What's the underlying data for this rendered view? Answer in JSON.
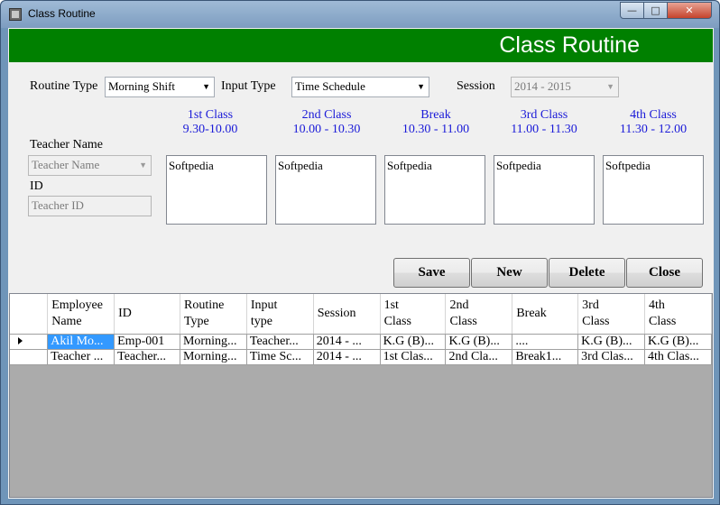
{
  "window": {
    "title": "Class Routine",
    "minimize_label": "—",
    "maximize_label": "□",
    "close_label": "✕"
  },
  "header": {
    "title": "Class Routine"
  },
  "form": {
    "routine_type_label": "Routine Type",
    "routine_type_value": "Morning Shift",
    "input_type_label": "Input Type",
    "input_type_value": "Time Schedule",
    "session_label": "Session",
    "session_value": "2014 - 2015",
    "teacher_name_label": "Teacher Name",
    "teacher_name_placeholder": "Teacher Name",
    "id_label": "ID",
    "teacher_id_placeholder": "Teacher ID"
  },
  "slots": [
    {
      "name": "1st Class",
      "time": "9.30-10.00",
      "value": "Softpedia"
    },
    {
      "name": "2nd Class",
      "time": "10.00 - 10.30",
      "value": "Softpedia"
    },
    {
      "name": "Break",
      "time": "10.30 - 11.00",
      "value": "Softpedia"
    },
    {
      "name": "3rd Class",
      "time": "11.00 - 11.30",
      "value": "Softpedia"
    },
    {
      "name": "4th Class",
      "time": "11.30 - 12.00",
      "value": "Softpedia"
    }
  ],
  "buttons": {
    "save": "Save",
    "new": "New",
    "delete": "Delete",
    "close": "Close"
  },
  "grid": {
    "columns": [
      {
        "line1": "Employee",
        "line2": "Name"
      },
      {
        "line1": "ID",
        "line2": ""
      },
      {
        "line1": "Routine",
        "line2": "Type"
      },
      {
        "line1": "Input",
        "line2": "type"
      },
      {
        "line1": "Session",
        "line2": ""
      },
      {
        "line1": "1st",
        "line2": "Class"
      },
      {
        "line1": "2nd",
        "line2": "Class"
      },
      {
        "line1": "Break",
        "line2": ""
      },
      {
        "line1": "3rd",
        "line2": "Class"
      },
      {
        "line1": "4th",
        "line2": "Class"
      }
    ],
    "rows": [
      [
        "Akil Mo...",
        "Emp-001",
        "Morning...",
        "Teacher...",
        "2014 - ...",
        "K.G (B)...",
        "K.G (B)...",
        "....",
        "K.G (B)...",
        "K.G (B)..."
      ],
      [
        "Teacher ...",
        "Teacher...",
        "Morning...",
        "Time Sc...",
        "2014 - ...",
        "1st Clas...",
        "2nd Cla...",
        "Break1...",
        "3rd Clas...",
        "4th Clas..."
      ]
    ]
  }
}
